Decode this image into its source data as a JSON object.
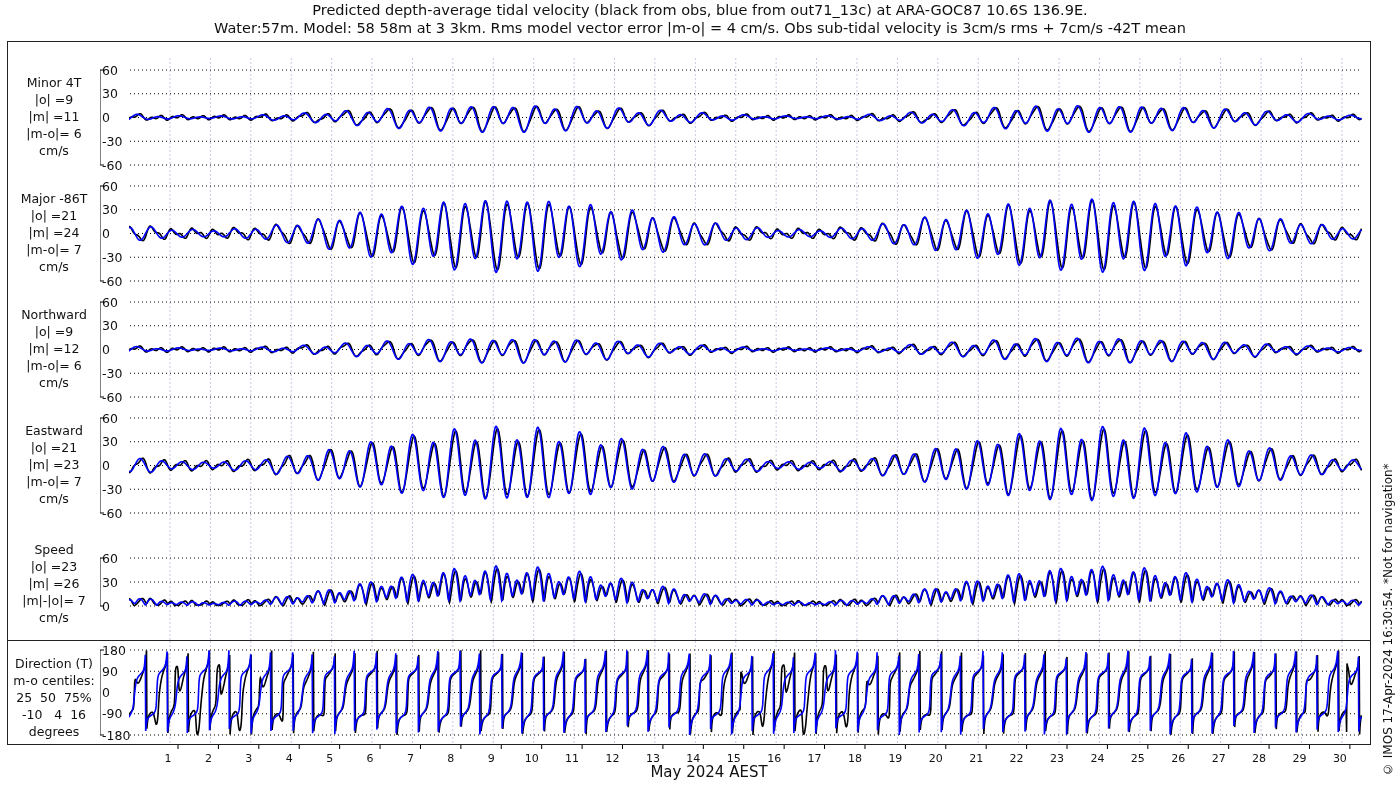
{
  "title_lines": [
    "Predicted depth-average tidal velocity (black from obs, blue from out71_13c) at ARA-GOC87 10.6S 136.9E.",
    "Water:57m. Model: 58 58m at 3 3km. Rms model vector error |m-o| = 4 cm/s. Obs sub-tidal velocity is 3cm/s rms + 7cm/s -42T mean"
  ],
  "panels": [
    {
      "kind": "minor",
      "label_lines": [
        "Minor 4T",
        "|o| =9",
        "|m| =11",
        "|m-o|= 6",
        "cm/s"
      ],
      "yticks": [
        "60",
        "30",
        "0",
        "-30",
        "-60"
      ]
    },
    {
      "kind": "major",
      "label_lines": [
        "Major -86T",
        "|o| =21",
        "|m| =24",
        "|m-o|= 7",
        "cm/s"
      ],
      "yticks": [
        "60",
        "30",
        "0",
        "-30",
        "-60"
      ]
    },
    {
      "kind": "north",
      "label_lines": [
        "Northward",
        "|o| =9",
        "|m| =12",
        "|m-o|= 6",
        "cm/s"
      ],
      "yticks": [
        "60",
        "30",
        "0",
        "-30",
        "-60"
      ]
    },
    {
      "kind": "east",
      "label_lines": [
        "Eastward",
        "|o| =21",
        "|m| =23",
        "|m-o|= 7",
        "cm/s"
      ],
      "yticks": [
        "60",
        "30",
        "0",
        "-30",
        "-60"
      ]
    },
    {
      "kind": "speed",
      "label_lines": [
        "Speed",
        "|o| =23",
        "|m| =26",
        "|m|-|o|= 7",
        "cm/s"
      ],
      "yticks": [
        "60",
        "30",
        "0"
      ]
    },
    {
      "kind": "direction",
      "label_lines": [
        "Direction (T)",
        "m-o centiles:",
        "25  50  75%",
        "-10   4  16",
        "degrees"
      ],
      "yticks": [
        "180",
        "90",
        "0",
        "-90",
        "-180"
      ]
    }
  ],
  "x_labels": [
    "1",
    "2",
    "3",
    "4",
    "5",
    "6",
    "7",
    "8",
    "9",
    "10",
    "11",
    "12",
    "13",
    "14",
    "15",
    "16",
    "17",
    "18",
    "19",
    "20",
    "21",
    "22",
    "23",
    "24",
    "25",
    "26",
    "27",
    "28",
    "29",
    "30"
  ],
  "xlabel": "May 2024 AEST",
  "credit": "© IMOS 17-Apr-2024 16:30:54. *Not for navigation*"
}
